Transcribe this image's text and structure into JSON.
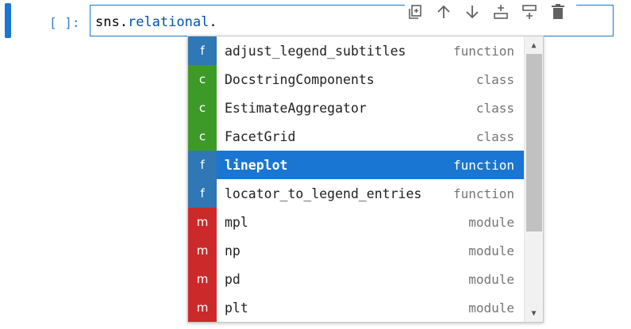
{
  "cell": {
    "prompt": "[ ]:",
    "code": {
      "module": "sns",
      "dot1": ".",
      "attr": "relational",
      "dot2": "."
    }
  },
  "toolbar": {
    "buttons": [
      {
        "icon": "duplicate-cell-icon"
      },
      {
        "icon": "move-up-icon"
      },
      {
        "icon": "move-down-icon"
      },
      {
        "icon": "insert-cell-above-icon"
      },
      {
        "icon": "insert-cell-below-icon"
      },
      {
        "icon": "delete-cell-icon"
      }
    ]
  },
  "colors": {
    "accent": "#1976d2",
    "function": "#2f77b5",
    "class": "#3e9a28",
    "module": "#cc2a2a"
  },
  "completer": {
    "items": [
      {
        "badge": "f",
        "label": "adjust_legend_subtitles",
        "type": "function"
      },
      {
        "badge": "c",
        "label": "DocstringComponents",
        "type": "class"
      },
      {
        "badge": "c",
        "label": "EstimateAggregator",
        "type": "class"
      },
      {
        "badge": "c",
        "label": "FacetGrid",
        "type": "class"
      },
      {
        "badge": "f",
        "label": "lineplot",
        "type": "function"
      },
      {
        "badge": "f",
        "label": "locator_to_legend_entries",
        "type": "function"
      },
      {
        "badge": "m",
        "label": "mpl",
        "type": "module"
      },
      {
        "badge": "m",
        "label": "np",
        "type": "module"
      },
      {
        "badge": "m",
        "label": "pd",
        "type": "module"
      },
      {
        "badge": "m",
        "label": "plt",
        "type": "module"
      }
    ],
    "selected_index": 4,
    "scrollbar": {
      "up_glyph": "▲",
      "down_glyph": "▼"
    }
  }
}
